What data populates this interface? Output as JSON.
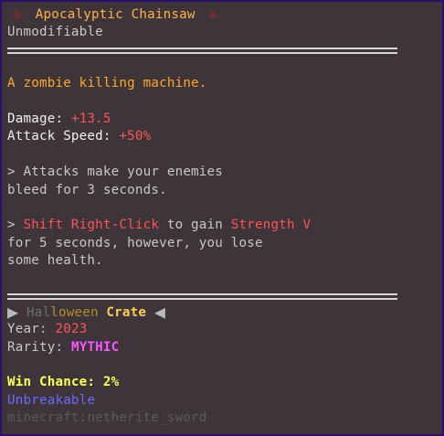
{
  "tooltip": {
    "title": "Apocalyptic Chainsaw",
    "title_icon_left": "skull-icon",
    "title_icon_right": "skull-icon",
    "subtitle": "Unmodifiable",
    "description": "A zombie killing machine.",
    "stats": {
      "damage_label": "Damage:",
      "damage_value": "+13.5",
      "speed_label": "Attack Speed:",
      "speed_value": "+50%"
    },
    "ability1": {
      "line1": "> Attacks make your enemies",
      "line2": "bleed for 3 seconds."
    },
    "ability2": {
      "prefix": "> ",
      "action": "Shift Right-Click",
      "mid": " to gain ",
      "effect": "Strength V",
      "line2": "for 5 seconds, however, you lose",
      "line3": "some health."
    },
    "crate": {
      "arrow_left": "▶",
      "name_a": "Hal",
      "name_b": "loween",
      "name_c": " Crate",
      "arrow_right": "◀"
    },
    "year": {
      "label": "Year:",
      "value": "2023"
    },
    "rarity": {
      "label": "Rarity:",
      "value": "MYTHIC"
    },
    "win": {
      "label": "Win Chance:",
      "value": "2%"
    },
    "unbreakable": "Unbreakable",
    "item_id": "minecraft:netherite_sword",
    "colors": {
      "background": "#3d3539",
      "border": "#2a0f6b",
      "title": "#ffb347",
      "red": "#ff5555",
      "mythic": "#ff55ff",
      "yellow": "#ffff55",
      "blue": "#6b6bff"
    }
  }
}
